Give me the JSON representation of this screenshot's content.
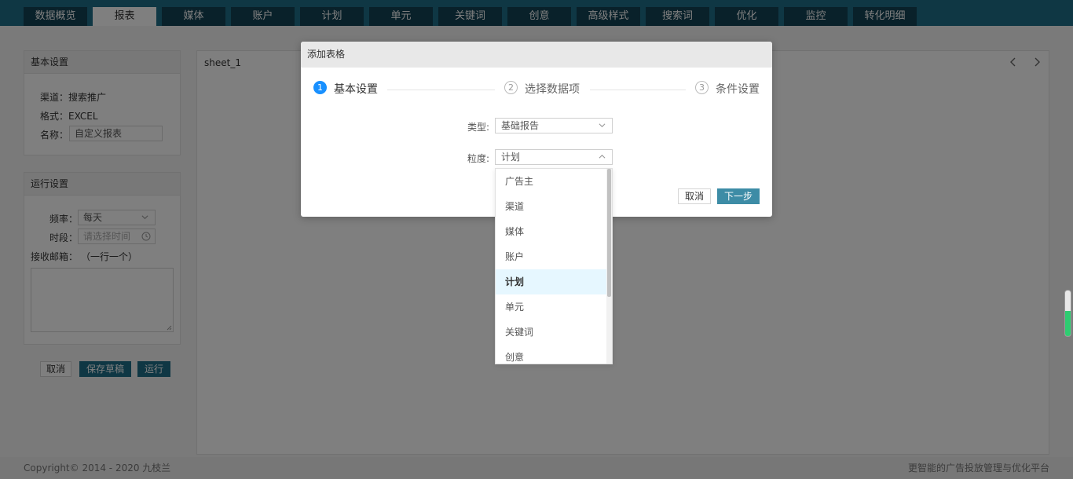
{
  "nav": {
    "tabs": [
      "数据概览",
      "报表",
      "媒体",
      "账户",
      "计划",
      "单元",
      "关键词",
      "创意",
      "高级样式",
      "搜索词",
      "优化",
      "监控",
      "转化明细"
    ],
    "active_index": 1
  },
  "basic": {
    "title": "基本设置",
    "channel": "渠道：搜索推广",
    "format": "格式：EXCEL",
    "name_label": "名称：",
    "name_value": "自定义报表"
  },
  "run": {
    "title": "运行设置",
    "freq_label": "频率：",
    "freq_value": "每天",
    "period_label": "时段：",
    "period_placeholder": "请选择时间",
    "email_label": "接收邮箱：",
    "email_hint": "（一行一个）"
  },
  "actions": {
    "cancel": "取消",
    "save": "保存草稿",
    "run": "运行"
  },
  "sheet": {
    "tab": "sheet_1",
    "prev": "‹",
    "next": "›"
  },
  "footer": {
    "copyright": "Copyright© 2014 - 2020 九枝兰",
    "slogan": "更智能的广告投放管理与优化平台"
  },
  "modal": {
    "title": "添加表格",
    "steps": [
      {
        "num": "1",
        "label": "基本设置"
      },
      {
        "num": "2",
        "label": "选择数据项"
      },
      {
        "num": "3",
        "label": "条件设置"
      }
    ],
    "type_label": "类型:",
    "type_value": "基础报告",
    "granularity_label": "粒度:",
    "granularity_value": "计划",
    "cancel": "取消",
    "next": "下一步"
  },
  "dropdown": {
    "items": [
      "广告主",
      "渠道",
      "媒体",
      "账户",
      "计划",
      "单元",
      "关键词",
      "创意"
    ],
    "selected_index": 4
  },
  "colors": {
    "nav_bg": "#1f6f88",
    "tab_bg": "#124255",
    "primary": "#1f6f88",
    "step_active": "#1890ff",
    "selected_item_bg": "#e6f7ff"
  }
}
